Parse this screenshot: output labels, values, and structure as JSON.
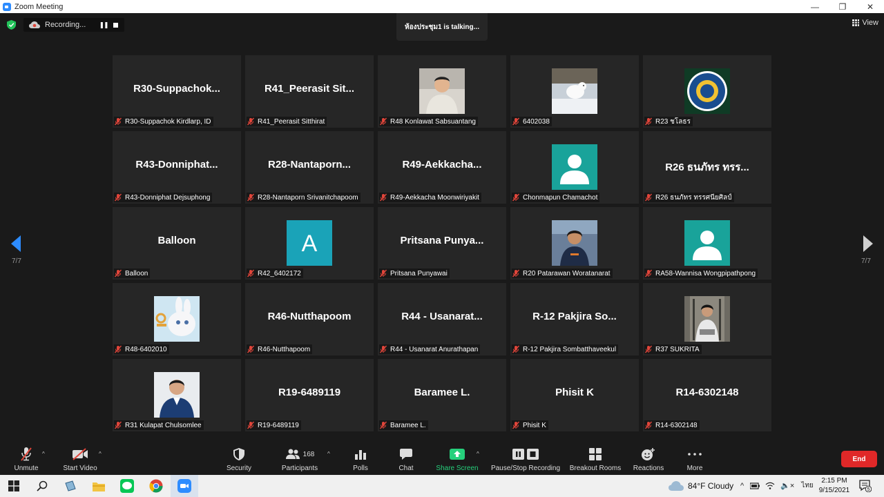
{
  "window": {
    "title": "Zoom Meeting"
  },
  "recording": {
    "label": "Recording..."
  },
  "talking": {
    "text": "ห้องประชุม1 is talking..."
  },
  "view": {
    "label": "View"
  },
  "pagination": {
    "left": "7/7",
    "right": "7/7"
  },
  "participants": [
    {
      "big": "R30-Suppachok...",
      "label": "R30-Suppachok Kirdlarp, ID",
      "avatar": ""
    },
    {
      "big": "R41_Peerasit  Sit...",
      "label": "R41_Peerasit Sitthirat",
      "avatar": ""
    },
    {
      "big": "",
      "label": "R48 Konlawat Sabsuantang",
      "avatar": "photo-man"
    },
    {
      "big": "",
      "label": "6402038",
      "avatar": "photo-snow-animal"
    },
    {
      "big": "",
      "label": "R23 ชโลธร",
      "avatar": "photo-university-seal"
    },
    {
      "big": "R43-Donniphat...",
      "label": "R43-Donniphat Dejsuphong",
      "avatar": ""
    },
    {
      "big": "R28-Nantaporn...",
      "label": "R28-Nantaporn Srivanitchapoom",
      "avatar": ""
    },
    {
      "big": "R49-Aekkacha...",
      "label": "R49-Aekkacha Moonwiriyakit",
      "avatar": ""
    },
    {
      "big": "",
      "label": "Chonmapun Chamachot",
      "avatar": "default-person"
    },
    {
      "big": "R26 ธนภัทร ทรร...",
      "label": "R26 ธนภัทร ทรรศนียศิลป์",
      "avatar": ""
    },
    {
      "big": "Balloon",
      "label": "Balloon",
      "avatar": ""
    },
    {
      "big": "",
      "label": "R42_6402172",
      "avatar": "letter",
      "letter": "A"
    },
    {
      "big": "Pritsana  Punya...",
      "label": "Pritsana Punyawai",
      "avatar": ""
    },
    {
      "big": "",
      "label": "R20 Patarawan Woratanarat",
      "avatar": "photo-woman"
    },
    {
      "big": "",
      "label": "RA58-Wannisa Wongpipathpong",
      "avatar": "default-person"
    },
    {
      "big": "",
      "label": "R48-6402010",
      "avatar": "photo-bunny"
    },
    {
      "big": "R46-Nutthapoom",
      "label": "R46-Nutthapoom",
      "avatar": ""
    },
    {
      "big": "R44  -  Usanarat...",
      "label": "R44 - Usanarat Anurathapan",
      "avatar": ""
    },
    {
      "big": "R-12  Pakjira So...",
      "label": "R-12 Pakjira Sombatthaveekul",
      "avatar": ""
    },
    {
      "big": "",
      "label": "R37 SUKRITA",
      "avatar": "photo-woman-2"
    },
    {
      "big": "",
      "label": "R31 Kulapat Chulsomlee",
      "avatar": "photo-doctor"
    },
    {
      "big": "R19-6489119",
      "label": "R19-6489119",
      "avatar": ""
    },
    {
      "big": "Baramee  L.",
      "label": "Baramee L.",
      "avatar": ""
    },
    {
      "big": "Phisit  K",
      "label": "Phisit K",
      "avatar": ""
    },
    {
      "big": "R14-6302148",
      "label": "R14-6302148",
      "avatar": ""
    }
  ],
  "toolbar": {
    "unmute": "Unmute",
    "start_video": "Start Video",
    "security": "Security",
    "participants": "Participants",
    "participants_count": "168",
    "polls": "Polls",
    "chat": "Chat",
    "share_screen": "Share Screen",
    "pause_recording": "Pause/Stop Recording",
    "breakout": "Breakout Rooms",
    "reactions": "Reactions",
    "more": "More",
    "end": "End"
  },
  "taskbar": {
    "weather": "84°F  Cloudy",
    "language": "ไทย",
    "time": "2:15 PM",
    "date": "9/15/2021",
    "notifications": "5"
  },
  "colors": {
    "accent": "#2d8cff",
    "share_green": "#26d07c",
    "end_red": "#e02828",
    "tile_bg": "#262626",
    "mic_red": "#e0453a"
  }
}
